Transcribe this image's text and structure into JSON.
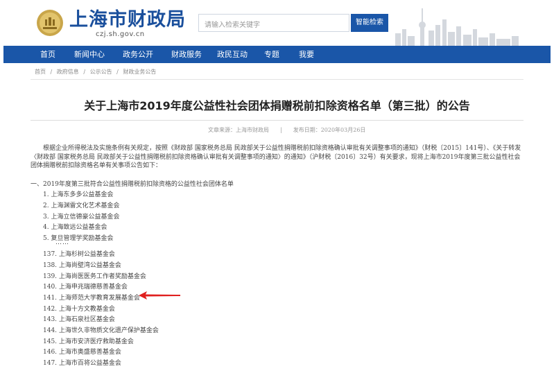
{
  "header": {
    "site_name": "上海市财政局",
    "site_url": "czj.sh.gov.cn",
    "emblem_icon": "shanghai-emblem-icon",
    "search_placeholder": "请输入检索关键字",
    "search_button": "智能检索",
    "skyline_icon": "city-skyline-icon"
  },
  "nav": {
    "items": [
      {
        "label": "首页"
      },
      {
        "label": "新闻中心"
      },
      {
        "label": "政务公开"
      },
      {
        "label": "财政服务"
      },
      {
        "label": "政民互动"
      },
      {
        "label": "专题"
      },
      {
        "label": "我要"
      }
    ],
    "bg_color": "#1a56a8"
  },
  "breadcrumb": {
    "items": [
      "首页",
      "/",
      "政府信息",
      "/",
      "公示公告",
      "/",
      "财政业务公告"
    ]
  },
  "article": {
    "title": "关于上海市2019年度公益性社会团体捐赠税前扣除资格名单（第三批）的公告",
    "source_label": "文章来源：上海市财政局",
    "sep": "|",
    "date_label": "发布日期：2020年03月26日",
    "paragraph": "根据企业所得税法及实施条例有关规定，按照《财政部 国家税务总局 民政部关于公益性捐赠税前扣除资格确认审批有关调整事项的通知》（财税〔2015〕141号）、《关于转发〈财政部 国家税务总局 民政部关于公益性捐赠税前扣除资格确认审批有关调整事项的通知〉的通知》（沪财税〔2016〕32号）有关要求，现将上海市2019年度第三批公益性社会团体捐赠税前扣除资格名单有关事项公告如下：",
    "section_head": "一、2019年度第三批符合公益性捐赠税前扣除资格的公益性社会团体名单",
    "list_top": [
      "1. 上海东多多公益基金会",
      "2. 上海渊雷文化艺术基金会",
      "3. 上海立信德豪公益基金会",
      "4. 上海致远公益基金会",
      "5. 复旦管理学奖励基金会"
    ],
    "ellipsis": "……",
    "list_bottom": [
      "137. 上海杉树公益基金会",
      "138. 上海尚壁湾公益基金会",
      "139. 上海尚医医务工作者奖励基金会",
      "140. 上海申兆瑞德慈善基金会",
      "141. 上海师范大学教育发展基金会",
      "142. 上海十方文教基金会",
      "143. 上海石泉社区基金会",
      "144. 上海世久非物质文化遗产保护基金会",
      "145. 上海市安济医疗救助基金会",
      "146. 上海市奥盛慈善基金会",
      "147. 上海市百将公益基金会"
    ],
    "arrow_color": "#e0201f"
  }
}
